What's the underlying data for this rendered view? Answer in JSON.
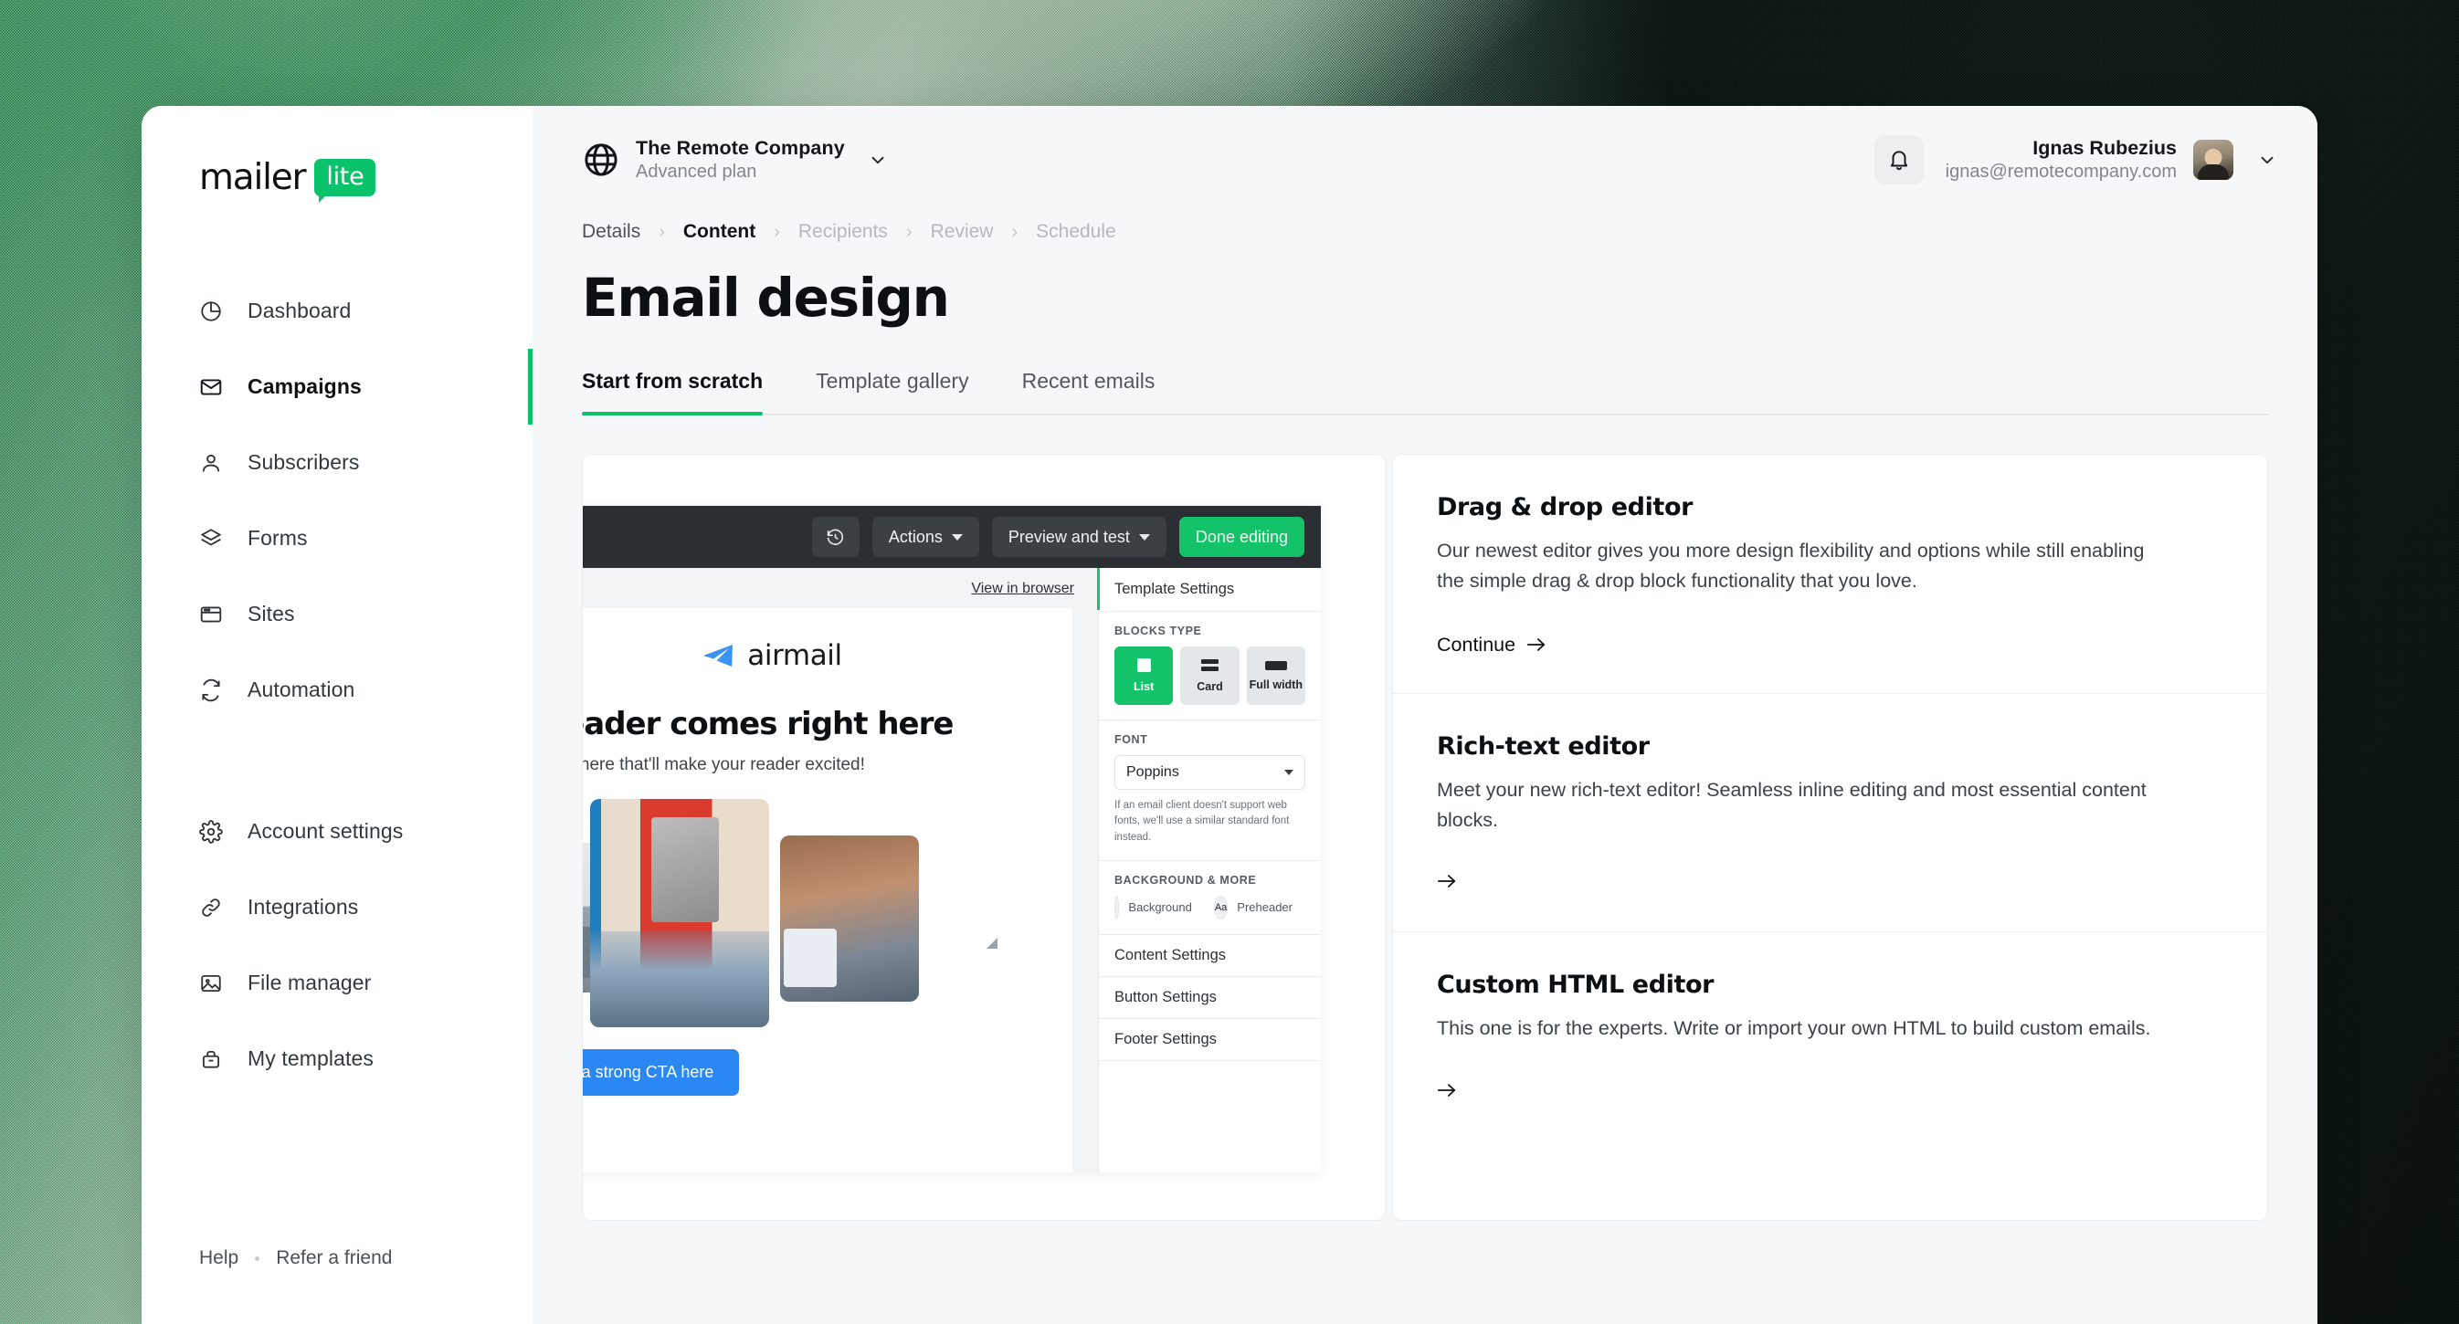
{
  "sidebar": {
    "logo": {
      "primary": "mailer",
      "badge": "lite"
    },
    "items": [
      {
        "label": "Dashboard",
        "icon": "pie-chart-icon",
        "active": false
      },
      {
        "label": "Campaigns",
        "icon": "envelope-icon",
        "active": true
      },
      {
        "label": "Subscribers",
        "icon": "user-icon",
        "active": false
      },
      {
        "label": "Forms",
        "icon": "layers-icon",
        "active": false
      },
      {
        "label": "Sites",
        "icon": "browser-window-icon",
        "active": false
      },
      {
        "label": "Automation",
        "icon": "refresh-icon",
        "active": false
      }
    ],
    "items2": [
      {
        "label": "Account settings",
        "icon": "gear-icon"
      },
      {
        "label": "Integrations",
        "icon": "link-icon"
      },
      {
        "label": "File manager",
        "icon": "image-icon"
      },
      {
        "label": "My templates",
        "icon": "archive-icon"
      }
    ],
    "footer": {
      "help": "Help",
      "refer": "Refer a friend"
    }
  },
  "topbar": {
    "org_name": "The Remote Company",
    "org_plan": "Advanced plan",
    "user_name": "Ignas Rubezius",
    "user_email": "ignas@remotecompany.com"
  },
  "breadcrumb": [
    {
      "label": "Details",
      "state": "done"
    },
    {
      "label": "Content",
      "state": "current"
    },
    {
      "label": "Recipients",
      "state": "upcoming"
    },
    {
      "label": "Review",
      "state": "upcoming"
    },
    {
      "label": "Schedule",
      "state": "upcoming"
    }
  ],
  "page": {
    "title": "Email design"
  },
  "tabs": [
    {
      "label": "Start from scratch",
      "active": true
    },
    {
      "label": "Template gallery",
      "active": false
    },
    {
      "label": "Recent emails",
      "active": false
    }
  ],
  "editor_preview": {
    "toolbar": {
      "history_icon": "history-undo-icon",
      "actions": "Actions",
      "preview": "Preview and test",
      "done": "Done editing"
    },
    "email": {
      "view_in_browser": "View in browser",
      "brand": "airmail",
      "headline": "y header comes right here",
      "subline": "mething here that'll make your reader excited!",
      "cta": "Write a strong CTA here"
    },
    "settings": {
      "header": "Template Settings",
      "blocks_label": "BLOCKS TYPE",
      "blocks": [
        {
          "label": "List",
          "selected": true
        },
        {
          "label": "Card",
          "selected": false
        },
        {
          "label": "Full width",
          "selected": false
        }
      ],
      "font_label": "FONT",
      "font_value": "Poppins",
      "font_hint": "If an email client doesn't support web fonts, we'll use a similar standard font instead.",
      "background_label": "BACKGROUND & MORE",
      "background_option": "Background",
      "preheader_option": "Preheader",
      "preheader_glyph": "Aa",
      "rows": [
        "Content Settings",
        "Button Settings",
        "Footer Settings"
      ]
    }
  },
  "cards": [
    {
      "title": "Drag & drop editor",
      "body": "Our newest editor gives you more design flexibility and options while still enabling the simple drag & drop block functionality that you love.",
      "link": "Continue"
    },
    {
      "title": "Rich-text editor",
      "body": "Meet your new rich-text editor! Seamless inline editing and most essential content blocks.",
      "link": ""
    },
    {
      "title": "Custom HTML editor",
      "body": "This one is for the experts. Write or import your own HTML to build custom emails.",
      "link": ""
    }
  ],
  "colors": {
    "brand_green": "#09C269",
    "editor_green": "#14C269",
    "cta_blue": "#2B87F2",
    "toolbar_dark": "#2B2F33"
  }
}
